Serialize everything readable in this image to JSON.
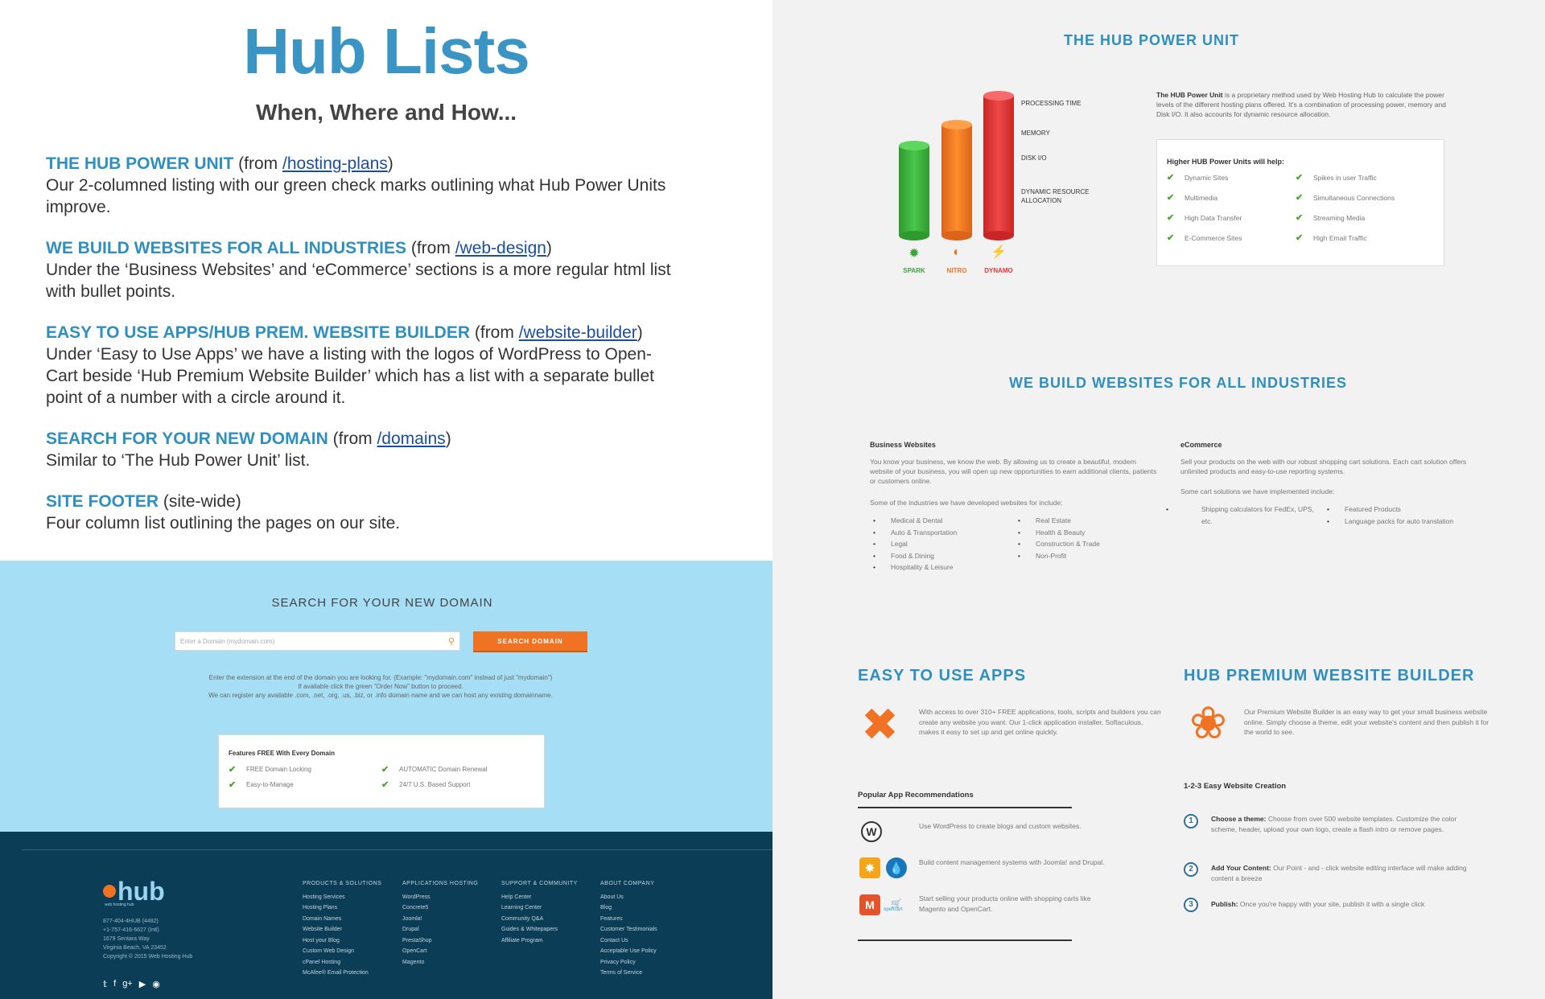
{
  "left": {
    "title": "Hub Lists",
    "subtitle": "When, Where and How...",
    "items": [
      {
        "title": "THE HUB POWER UNIT",
        "from_prefix": " (from ",
        "link": "/hosting-plans",
        "from_suffix": ")",
        "desc": "Our 2-columned listing with our green check marks outlining what Hub Power Units improve."
      },
      {
        "title": "WE BUILD WEBSITES FOR ALL INDUSTRIES",
        "from_prefix": " (from ",
        "link": "/web-design",
        "from_suffix": ")",
        "desc": "Under the ‘Business Websites’ and ‘eCommerce’ sections is a more regular html list with bullet points."
      },
      {
        "title": "EASY TO USE APPS/HUB PREM. WEBSITE BUILDER",
        "from_prefix": " (from ",
        "link": "/website-builder",
        "from_suffix": ")",
        "desc": "Under ‘Easy to Use Apps’ we have a listing with the logos of WordPress to Open-Cart beside ‘Hub Premium Website Builder’ which has a list with a separate bullet point of a number with a circle around it."
      },
      {
        "title": "SEARCH FOR YOUR NEW DOMAIN",
        "from_prefix": " (from ",
        "link": "/domains",
        "from_suffix": ")",
        "desc": "Similar to ‘The Hub Power Unit’ list."
      },
      {
        "title": "SITE FOOTER",
        "from_prefix": " (site-wide)",
        "link": "",
        "from_suffix": "",
        "desc": "Four column list outlining the pages on our site."
      }
    ]
  },
  "domain": {
    "heading": "SEARCH FOR YOUR NEW DOMAIN",
    "placeholder": "Enter a Domain (mydomain.com)",
    "button": "SEARCH DOMAIN",
    "notes": [
      "Enter the extension at the end of the domain you are looking for. (Example: \"mydomain.com\" instead of just \"mydomain\")",
      "If available click the green \"Order Now\" button to proceed.",
      "We can register any available .com, .net, .org, .us, .biz, or .info domain name and we can host any existing domainname."
    ],
    "features_title": "Features FREE With Every Domain",
    "features": [
      "FREE Domain Locking",
      "AUTOMATIC Domain Renewal",
      "Easy-to-Manage",
      "24/7 U.S. Based Support"
    ]
  },
  "footer": {
    "logo": "hub",
    "tagline": "web hosting hub",
    "contact": [
      "877-404-4HUB (4482)",
      "+1-757-416-6627 (Intl)",
      "1679 Sentara Way",
      "Virginia Beach, VA 23452",
      "Copyright © 2015 Web Hosting Hub"
    ],
    "columns": [
      {
        "title": "PRODUCTS & SOLUTIONS",
        "links": [
          "Hosting Services",
          "Hosting Plans",
          "Domain Names",
          "Website Builder",
          "Host your Blog",
          "Custom Web Design",
          "cPanel Hosting",
          "McAfee® Email Protection"
        ]
      },
      {
        "title": "APPLICATIONS HOSTING",
        "links": [
          "WordPress",
          "Concrete5",
          "Joomla!",
          "Drupal",
          "PrestaShop",
          "OpenCart",
          "Magento"
        ]
      },
      {
        "title": "SUPPORT & COMMUNITY",
        "links": [
          "Help Center",
          "Learning Center",
          "Community Q&A",
          "Guides & Whitepapers",
          "Affiliate Program"
        ]
      },
      {
        "title": "ABOUT COMPANY",
        "links": [
          "About Us",
          "Blog",
          "Features",
          "Customer Testimonials",
          "Contact Us",
          "Acceptable Use Policy",
          "Privacy Policy",
          "Terms of Service"
        ]
      }
    ]
  },
  "power": {
    "heading": "THE HUB POWER UNIT",
    "labels": [
      "PROCESSING TIME",
      "MEMORY",
      "DISK I/O",
      "DYNAMIC RESOURCE",
      "ALLOCATION"
    ],
    "plans": [
      "SPARK",
      "NITRO",
      "DYNAMO"
    ],
    "desc_bold": "The HUB Power Unit",
    "desc": " is a proprietary method used by Web Hosting Hub to calculate the power levels of the different hosting plans offered. It's a combination of processing power, memory and Disk I/O. It also accounts for dynamic resource allocation.",
    "box_title": "Higher HUB Power Units will help:",
    "items": [
      "Dynamic Sites",
      "Spikes in user Traffic",
      "Multimedia",
      "Simultaneous Connections",
      "High Data Transfer",
      "Streaming Media",
      "E-Commerce Sites",
      "High Email Traffic"
    ]
  },
  "industries": {
    "heading": "WE BUILD WEBSITES FOR ALL INDUSTRIES",
    "business": {
      "title": "Business Websites",
      "p1": "You know your business, we know the web. By allowing us to create a beautiful, modern website of your business, you will open up new opportunities to earn additional clients, patients or customers online.",
      "p2": "Some of the industries we have developed websites for include:",
      "col1": [
        "Medical & Dental",
        "Auto & Transportation",
        "Legal",
        "Food & Dining",
        "Hospitality & Leisure"
      ],
      "col2": [
        "Real Estate",
        "Health & Beauty",
        "Construction & Trade",
        "Non-Profit"
      ]
    },
    "ecommerce": {
      "title": "eCommerce",
      "p1": "Sell your products on the web with our robust shopping cart solutions. Each cart solution offers unlimited products and easy-to-use reporting systems.",
      "p2": "Some cart solutions we have implemented include:",
      "col1": [
        "Shipping calculators for FedEx, UPS, etc."
      ],
      "col2": [
        "Featured Products",
        "Language packs for auto translation"
      ]
    }
  },
  "apps": {
    "heading": "EASY TO USE APPS",
    "desc": "With access to over 310+ FREE applications, tools, scripts and builders you can create any website you want. Our 1-click application installer, Softaculous, makes it easy to set up and get online quickly.",
    "rec_title": "Popular App Recommendations",
    "recs": [
      "Use WordPress to create blogs and custom websites.",
      "Build content management systems with Joomla! and Drupal.",
      "Start selling your products online with shopping carts like Magento and OpenCart."
    ],
    "opencart_label": "opencart"
  },
  "builder": {
    "heading": "HUB PREMIUM WEBSITE BUILDER",
    "desc": "Our Premium Website Builder is an easy way to get your small business website online. Simply choose a theme, edit your website's content and then publish it for the world to see.",
    "steps_title": "1-2-3 Easy Website Creation",
    "steps": [
      {
        "num": "1",
        "bold": "Choose a theme:",
        "text": " Choose from over 500 website templates. Customize the color scheme, header, upload your own logo, create a flash intro or remove pages."
      },
      {
        "num": "2",
        "bold": "Add Your Content:",
        "text": " Our Point - and - click website editing interface will make adding content a breeze"
      },
      {
        "num": "3",
        "bold": "Publish:",
        "text": " Once you're happy with your site, publish it with a single click"
      }
    ]
  }
}
